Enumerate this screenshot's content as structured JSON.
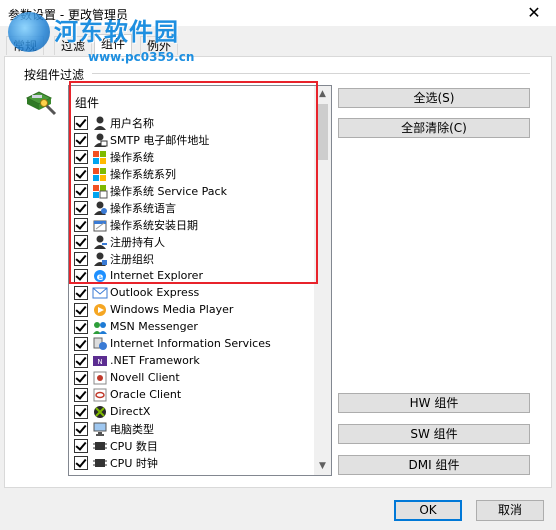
{
  "window": {
    "title": "参数设置 - 更改管理员",
    "close_glyph": "✕"
  },
  "watermark": {
    "title": "河东软件园",
    "url": "www.pc0359.cn"
  },
  "tabs": [
    {
      "label": "常规"
    },
    {
      "label": "过滤"
    },
    {
      "label": "组件"
    },
    {
      "label": "例外"
    }
  ],
  "group": {
    "label": "按组件过滤",
    "icon": "filter-components-icon"
  },
  "list": {
    "header": "组件",
    "items": [
      {
        "label": "用户名称",
        "icon": "user-icon",
        "checked": true
      },
      {
        "label": "SMTP 电子邮件地址",
        "icon": "mail-icon",
        "checked": true
      },
      {
        "label": "操作系统",
        "icon": "windows-icon",
        "checked": true
      },
      {
        "label": "操作系统系列",
        "icon": "windows-icon",
        "checked": true
      },
      {
        "label": "操作系统 Service Pack",
        "icon": "service-pack-icon",
        "checked": true
      },
      {
        "label": "操作系统语言",
        "icon": "language-icon",
        "checked": true
      },
      {
        "label": "操作系统安装日期",
        "icon": "install-date-icon",
        "checked": true
      },
      {
        "label": "注册持有人",
        "icon": "owner-icon",
        "checked": true
      },
      {
        "label": "注册组织",
        "icon": "organization-icon",
        "checked": true
      },
      {
        "label": "Internet Explorer",
        "icon": "ie-icon",
        "checked": true
      },
      {
        "label": "Outlook Express",
        "icon": "outlook-icon",
        "checked": true
      },
      {
        "label": "Windows Media Player",
        "icon": "media-player-icon",
        "checked": true
      },
      {
        "label": "MSN Messenger",
        "icon": "msn-icon",
        "checked": true
      },
      {
        "label": "Internet Information Services",
        "icon": "iis-icon",
        "checked": true
      },
      {
        "label": ".NET Framework",
        "icon": "dotnet-icon",
        "checked": true
      },
      {
        "label": "Novell Client",
        "icon": "novell-icon",
        "checked": true
      },
      {
        "label": "Oracle Client",
        "icon": "oracle-icon",
        "checked": true
      },
      {
        "label": "DirectX",
        "icon": "directx-icon",
        "checked": true
      },
      {
        "label": "电脑类型",
        "icon": "computer-icon",
        "checked": true
      },
      {
        "label": "CPU 数目",
        "icon": "cpu-icon",
        "checked": true
      },
      {
        "label": "CPU 时钟",
        "icon": "cpu-icon",
        "checked": true
      }
    ]
  },
  "buttons": {
    "select_all": "全选(S)",
    "clear_all": "全部清除(C)",
    "hw": "HW 组件",
    "sw": "SW 组件",
    "dmi": "DMI 组件",
    "ok": "OK",
    "cancel": "取消"
  },
  "colors": {
    "highlight": "#e8232b",
    "watermark": "#1e8fe0"
  }
}
